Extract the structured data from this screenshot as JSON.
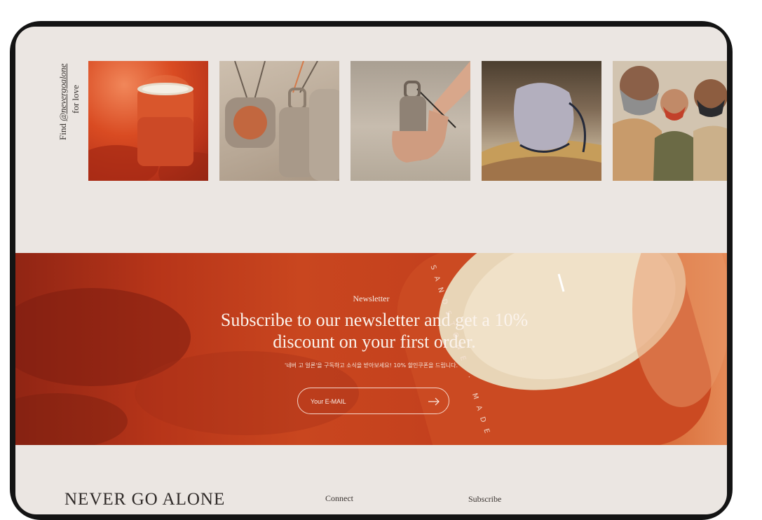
{
  "instagram": {
    "caption_prefix": "Find",
    "handle": "@nevergoalone",
    "caption_suffix": "for love",
    "images": [
      {
        "name": "sandstone-candle"
      },
      {
        "name": "grey-hand-sanitizer-pendants"
      },
      {
        "name": "sanitizer-in-hand"
      },
      {
        "name": "grey-mask-on-rock"
      },
      {
        "name": "people-wearing-masks"
      }
    ]
  },
  "newsletter": {
    "kicker": "Newsletter",
    "title": "Subscribe to our newsletter and get a 10% discount on your first order.",
    "subtitle": "'네버 고 얼론'을 구독하고 소식을 받아보세요! 10% 할인쿠폰을 드립니다.",
    "email_placeholder": "Your E-MAIL",
    "candle_text": "SANDSTONE · MADE IN"
  },
  "footer": {
    "brand": "NEVER GO ALONE",
    "connect": "Connect",
    "subscribe": "Subscribe"
  },
  "colors": {
    "background": "#ebe6e2",
    "accent": "#c9461f",
    "text_dark": "#2f2a28"
  }
}
